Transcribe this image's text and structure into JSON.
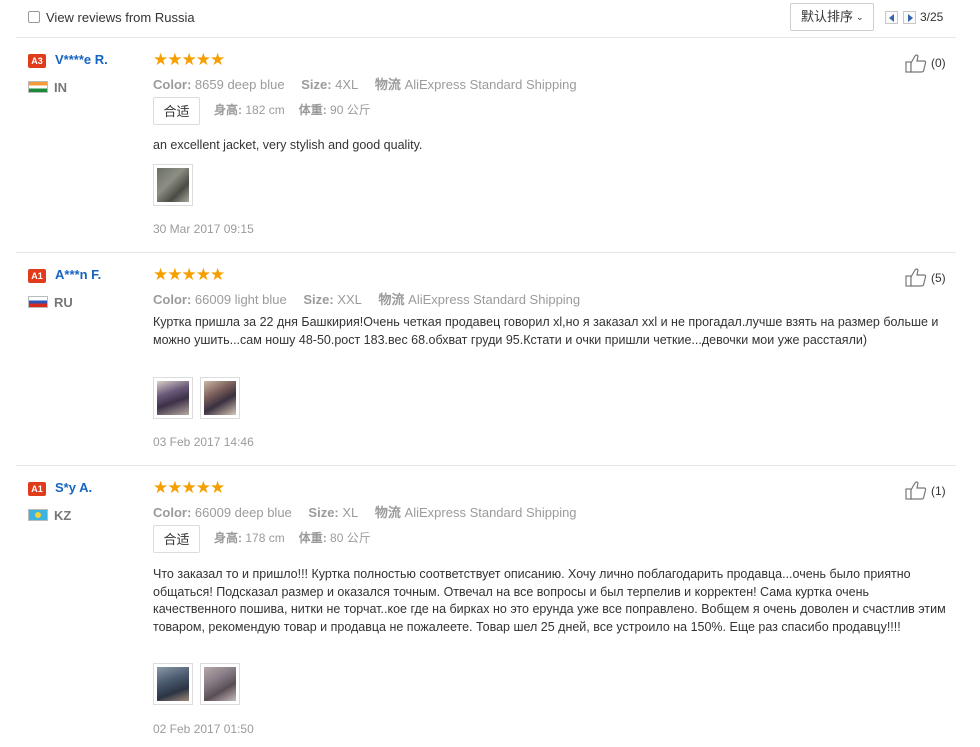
{
  "toolbar": {
    "filter_label": "View reviews from Russia",
    "sort_label": "默认排序",
    "page_indicator": "3/25"
  },
  "labels": {
    "color": "Color:",
    "size": "Size:",
    "shipping": "物流",
    "height": "身高:",
    "weight": "体重:"
  },
  "reviews": [
    {
      "badge": "A3",
      "user": "V****e R.",
      "country": "IN",
      "stars": "★★★★★",
      "color_value": "8659 deep blue",
      "size_value": "4XL",
      "shipping_value": "AliExpress Standard Shipping",
      "fit": "合适",
      "height_value": "182 cm",
      "weight_value": "90 公斤",
      "text": "an excellent jacket, very stylish and good quality.",
      "date": "30 Mar 2017 09:15",
      "likes": "(0)"
    },
    {
      "badge": "A1",
      "user": "A***n F.",
      "country": "RU",
      "stars": "★★★★★",
      "color_value": "66009 light blue",
      "size_value": "XXL",
      "shipping_value": "AliExpress Standard Shipping",
      "text": "Куртка пришла за 22 дня Башкирия!Очень четкая продавец говорил xl,но я заказал xxl и не прогадал.лучше взять на размер больше и можно ушить...сам ношу 48-50.рост 183.вес 68.обхват груди 95.Кстати и очки пришли четкие...девочки мои уже расстаяли)",
      "date": "03 Feb 2017 14:46",
      "likes": "(5)"
    },
    {
      "badge": "A1",
      "user": "S*y A.",
      "country": "KZ",
      "stars": "★★★★★",
      "color_value": "66009 deep blue",
      "size_value": "XL",
      "shipping_value": "AliExpress Standard Shipping",
      "fit": "合适",
      "height_value": "178 cm",
      "weight_value": "80 公斤",
      "text": "Что заказал то и пришло!!! Куртка полностью соответствует описанию. Хочу лично поблагодарить продавца...очень было приятно общаться! Подсказал размер и оказался точным. Отвечал на все вопросы и был терпелив и корректен! Сама куртка очень качественного пошива, нитки не торчат..кое где на бирках но это ерунда уже все поправлено. Вобщем я очень доволен и счастлив этим товаром, рекомендую товар и продавца не пожалеете. Товар шел 25 дней, все устроило на 150%. Еще раз спасибо продавцу!!!!",
      "date": "02 Feb 2017 01:50",
      "likes": "(1)"
    }
  ]
}
